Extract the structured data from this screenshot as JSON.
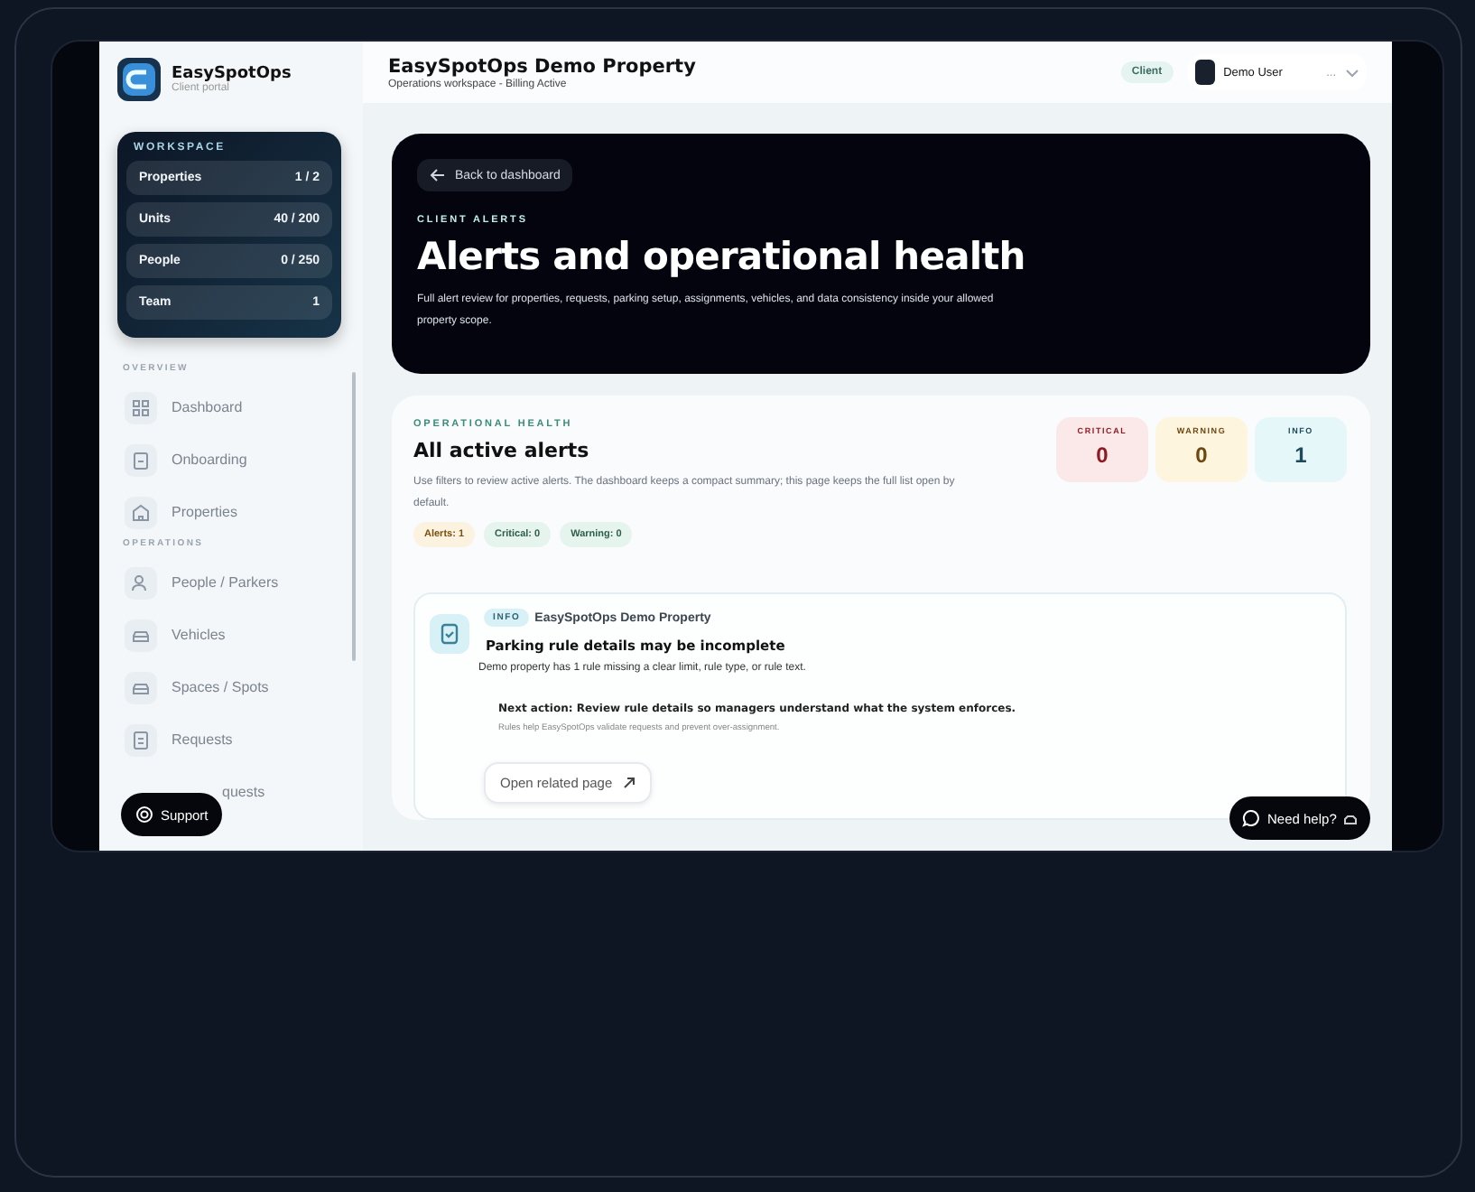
{
  "brand": {
    "name": "EasySpotOps",
    "subtitle": "Client portal"
  },
  "workspace": {
    "title": "WORKSPACE",
    "rows": [
      {
        "label": "Properties",
        "value": "1 / 2"
      },
      {
        "label": "Units",
        "value": "40 / 200"
      },
      {
        "label": "People",
        "value": "0 / 250"
      },
      {
        "label": "Team",
        "value": "1"
      }
    ]
  },
  "nav": [
    {
      "section": "OVERVIEW",
      "items": [
        {
          "label": "Dashboard"
        },
        {
          "label": "Onboarding"
        },
        {
          "label": "Properties"
        }
      ]
    },
    {
      "section": "OPERATIONS",
      "items": [
        {
          "label": "People / Parkers"
        },
        {
          "label": "Vehicles"
        },
        {
          "label": "Spaces / Spots"
        },
        {
          "label": "Requests"
        },
        {
          "label": "quests"
        }
      ]
    }
  ],
  "support_button": "Support",
  "header": {
    "title": "EasySpotOps Demo Property",
    "subtitle": "Operations workspace - Billing Active",
    "role_badge": "Client",
    "user": "Demo User",
    "menu": "..."
  },
  "hero": {
    "back": "Back to dashboard",
    "eyebrow": "CLIENT ALERTS",
    "title": "Alerts and operational health",
    "description": "Full alert review for properties, requests, parking setup, assignments, vehicles, and data consistency inside your allowed property scope."
  },
  "health": {
    "eyebrow": "OPERATIONAL HEALTH",
    "title": "All active alerts",
    "description": "Use filters to review active alerts. The dashboard keeps a compact summary; this page keeps the full list open by default.",
    "chips": [
      {
        "label": "Alerts: 1",
        "kind": "warning"
      },
      {
        "label": "Critical: 0",
        "kind": "ok"
      },
      {
        "label": "Warning: 0",
        "kind": "ok"
      }
    ],
    "counters": [
      {
        "label": "CRITICAL",
        "value": "0",
        "kind": "critical"
      },
      {
        "label": "WARNING",
        "value": "0",
        "kind": "warning"
      },
      {
        "label": "INFO",
        "value": "1",
        "kind": "info"
      }
    ]
  },
  "alerts": [
    {
      "severity": "INFO",
      "property": "EasySpotOps Demo Property",
      "title": "Parking rule details may be incomplete",
      "description": "Demo property has 1 rule missing a clear limit, rule type, or rule text.",
      "next_action": "Next action: Review rule details so managers understand what the system enforces.",
      "note": "Rules help EasySpotOps validate requests and prevent over-assignment.",
      "link": "Open related page"
    }
  ],
  "help_button": "Need help?"
}
